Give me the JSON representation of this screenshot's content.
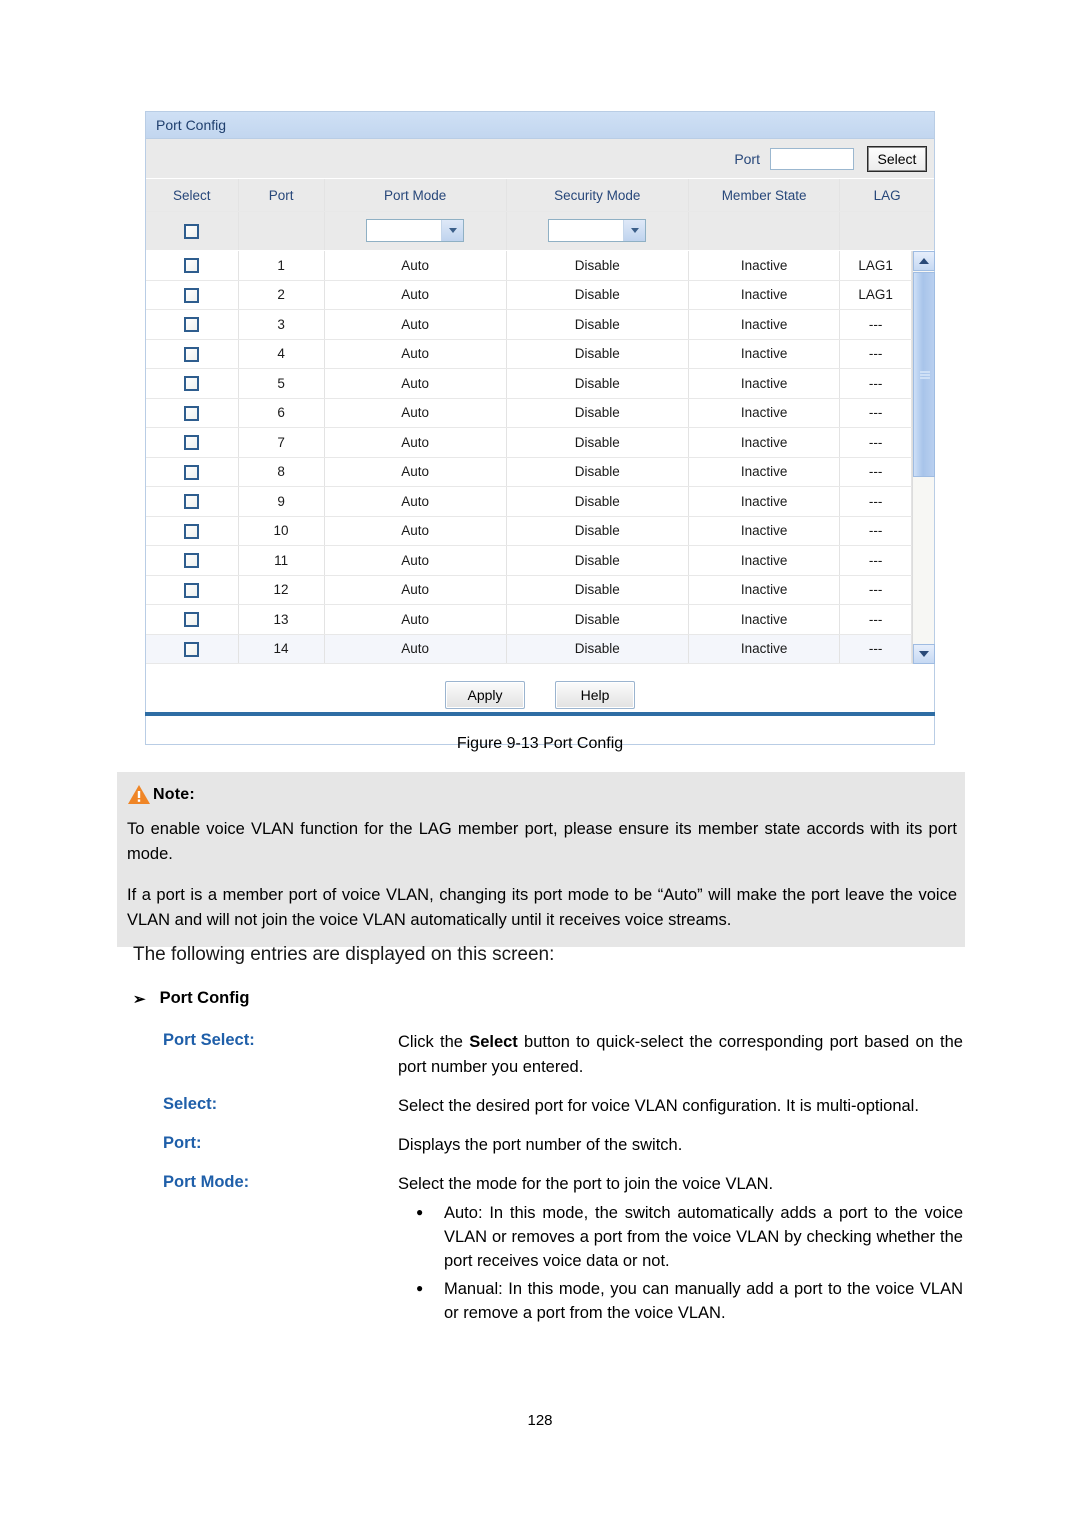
{
  "panel": {
    "title": "Port Config",
    "filter": {
      "port_label": "Port",
      "port_value": "",
      "port_placeholder": "",
      "select_button": "Select"
    },
    "columns": [
      "Select",
      "Port",
      "Port Mode",
      "Security Mode",
      "Member State",
      "LAG"
    ],
    "filter_row": {
      "port_mode_value": "",
      "security_mode_value": ""
    },
    "rows": [
      {
        "port": "1",
        "port_mode": "Auto",
        "security_mode": "Disable",
        "member_state": "Inactive",
        "lag": "LAG1"
      },
      {
        "port": "2",
        "port_mode": "Auto",
        "security_mode": "Disable",
        "member_state": "Inactive",
        "lag": "LAG1"
      },
      {
        "port": "3",
        "port_mode": "Auto",
        "security_mode": "Disable",
        "member_state": "Inactive",
        "lag": "---"
      },
      {
        "port": "4",
        "port_mode": "Auto",
        "security_mode": "Disable",
        "member_state": "Inactive",
        "lag": "---"
      },
      {
        "port": "5",
        "port_mode": "Auto",
        "security_mode": "Disable",
        "member_state": "Inactive",
        "lag": "---"
      },
      {
        "port": "6",
        "port_mode": "Auto",
        "security_mode": "Disable",
        "member_state": "Inactive",
        "lag": "---"
      },
      {
        "port": "7",
        "port_mode": "Auto",
        "security_mode": "Disable",
        "member_state": "Inactive",
        "lag": "---"
      },
      {
        "port": "8",
        "port_mode": "Auto",
        "security_mode": "Disable",
        "member_state": "Inactive",
        "lag": "---"
      },
      {
        "port": "9",
        "port_mode": "Auto",
        "security_mode": "Disable",
        "member_state": "Inactive",
        "lag": "---"
      },
      {
        "port": "10",
        "port_mode": "Auto",
        "security_mode": "Disable",
        "member_state": "Inactive",
        "lag": "---"
      },
      {
        "port": "11",
        "port_mode": "Auto",
        "security_mode": "Disable",
        "member_state": "Inactive",
        "lag": "---"
      },
      {
        "port": "12",
        "port_mode": "Auto",
        "security_mode": "Disable",
        "member_state": "Inactive",
        "lag": "---"
      },
      {
        "port": "13",
        "port_mode": "Auto",
        "security_mode": "Disable",
        "member_state": "Inactive",
        "lag": "---"
      },
      {
        "port": "14",
        "port_mode": "Auto",
        "security_mode": "Disable",
        "member_state": "Inactive",
        "lag": "---"
      }
    ],
    "buttons": {
      "apply": "Apply",
      "help": "Help"
    }
  },
  "figure_caption": "Figure 9-13 Port Config",
  "note": {
    "label": "Note:",
    "icon": "warning-triangle-icon",
    "paragraphs": [
      "To enable voice VLAN function for the LAG member port, please ensure its member state accords with its port mode.",
      "If a port is a member port of voice VLAN, changing its port mode to be “Auto” will make the port leave the voice VLAN and will not join the voice VLAN automatically until it receives voice streams."
    ]
  },
  "prose": {
    "intro": "The following entries are displayed on this screen:",
    "section_bullet": "➢",
    "section_title": "Port Config"
  },
  "definitions": [
    {
      "term": "Port Select:",
      "desc_before": "Click the ",
      "desc_bold": "Select",
      "desc_after": " button to quick-select the corresponding port based on the port number you entered."
    },
    {
      "term": "Select:",
      "desc": "Select the desired port for voice VLAN configuration. It is multi-optional."
    },
    {
      "term": "Port:",
      "desc": "Displays the port number of the switch."
    },
    {
      "term": "Port Mode:",
      "desc": "Select the mode for the port to join the voice VLAN.",
      "bullets": [
        "Auto: In this mode, the switch automatically adds a port to the voice VLAN or removes a port from the voice VLAN by checking whether the port receives voice data or not.",
        "Manual: In this mode, you can manually add a port to the voice VLAN or remove a port from the voice VLAN."
      ]
    }
  ],
  "page_number": "128",
  "colors": {
    "panel_title_bg": "#c5d9f1",
    "header_text": "#27477a",
    "term_text": "#1f5fa9",
    "rule": "#2e6da4",
    "note_bg": "#e6e6e6",
    "warn_icon": "#ef8526"
  }
}
